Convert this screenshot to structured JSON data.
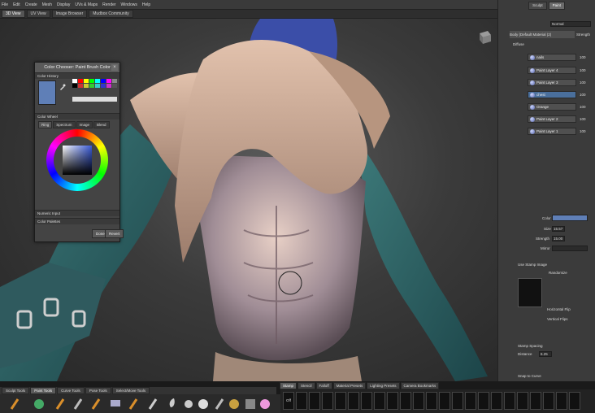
{
  "menu": {
    "items": [
      "File",
      "Edit",
      "Create",
      "Mesh",
      "Display",
      "UVs & Maps",
      "Render",
      "Windows",
      "Help"
    ]
  },
  "doc_tabs": [
    "3D View",
    "UV View",
    "Image Browser",
    "Mudbox Community"
  ],
  "color_chooser": {
    "title": "Color Chooser: Paint Brush Color",
    "color_history_label": "Color History",
    "color_wheel_label": "Color Wheel",
    "subtabs": [
      "Ring",
      "Spectrum",
      "Image",
      "Blend"
    ],
    "numeric_input_label": "Numeric Input",
    "color_palettes_label": "Color Palettes",
    "done_label": "Done",
    "revert_label": "Revert",
    "current_color": "#5f7fb7"
  },
  "right_panel": {
    "tabs": [
      "Sculpt",
      "Paint"
    ],
    "blend_mode": "Normal",
    "material_label": "Body (Default Material (2)",
    "strength_label": "Strength",
    "diffuse_label": "Diffuse",
    "layers": [
      {
        "name": "nails",
        "value": "100"
      },
      {
        "name": "Paint Layer 4",
        "value": "100"
      },
      {
        "name": "Paint Layer 3",
        "value": "100"
      },
      {
        "name": "chest",
        "value": "100",
        "selected": true
      },
      {
        "name": "Orange",
        "value": "100"
      },
      {
        "name": "Paint Layer 2",
        "value": "100"
      },
      {
        "name": "Paint Layer 1",
        "value": "100"
      }
    ],
    "props": {
      "color_label": "Color",
      "size_label": "Size",
      "size_value": "15.57",
      "strength_label": "Strength",
      "strength_value": "15.00",
      "mirror_label": "Mirror",
      "use_stamp_label": "Use Stamp Image",
      "randomize_label": "Randomize",
      "horizontal_flip_label": "Horizontal Flip",
      "vertical_flip_label": "Vertical Flips",
      "stamp_spacing_label": "Stamp Spacing",
      "distance_label": "Distance",
      "distance_value": "6.25",
      "snap_label": "Snap to Curve"
    }
  },
  "bottom_tabs": [
    "Sculpt Tools",
    "Paint Tools",
    "Curve Tools",
    "Pose Tools",
    "Select/Move Tools"
  ],
  "stamp_tabs": [
    "Stamp",
    "Stencil",
    "Falloff",
    "Material Presets",
    "Lighting Presets",
    "Camera Bookmarks"
  ],
  "stamp_off_label": "Off",
  "accent_color": "#4a6f9c"
}
